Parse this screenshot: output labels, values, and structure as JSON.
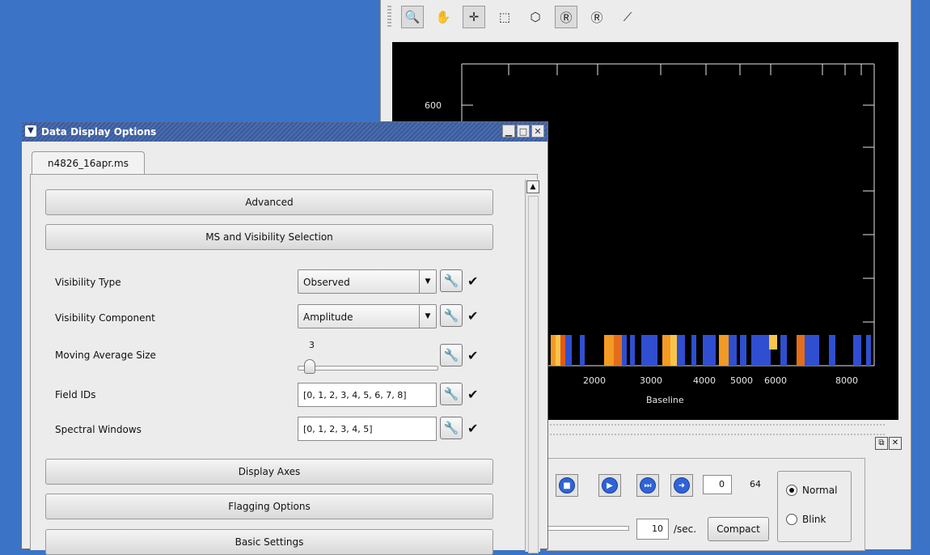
{
  "viewer": {
    "toolbar_icons": [
      "zoom-icon",
      "pan-icon",
      "crosshair-icon",
      "rectangle-icon",
      "polygon-icon",
      "region-r-icon",
      "region-r2-icon",
      "polyline-icon"
    ],
    "plot": {
      "ytick": "600",
      "xticks": [
        "2000",
        "3000",
        "4000",
        "5000",
        "6000",
        "8000"
      ],
      "xlabel": "Baseline"
    },
    "animation": {
      "frame_value": "0",
      "frame_total": "64",
      "rate_value": "10",
      "rate_unit": "/sec.",
      "compact_label": "Compact",
      "mode_normal": "Normal",
      "mode_blink": "Blink",
      "selected_mode": "Normal"
    }
  },
  "dialog": {
    "title": "Data Display Options",
    "tab_label": "n4826_16apr.ms",
    "sections": {
      "advanced": "Advanced",
      "ms_selection": "MS and Visibility Selection",
      "display_axes": "Display Axes",
      "flagging": "Flagging Options",
      "basic": "Basic Settings"
    },
    "rows": {
      "visibility_type": {
        "label": "Visibility Type",
        "value": "Observed"
      },
      "visibility_component": {
        "label": "Visibility Component",
        "value": "Amplitude"
      },
      "moving_average": {
        "label": "Moving Average Size",
        "value": "3"
      },
      "field_ids": {
        "label": "Field IDs",
        "value": "[0, 1, 2, 3, 4, 5, 6, 7, 8]"
      },
      "spectral_windows": {
        "label": "Spectral Windows",
        "value": "[0, 1, 2, 3, 4, 5]"
      }
    }
  },
  "colors": {
    "desktop": "#3b73c6",
    "titlebar": "#4b6db0",
    "raster_blue": "#2f4fd0",
    "raster_orange": "#f39a24"
  }
}
